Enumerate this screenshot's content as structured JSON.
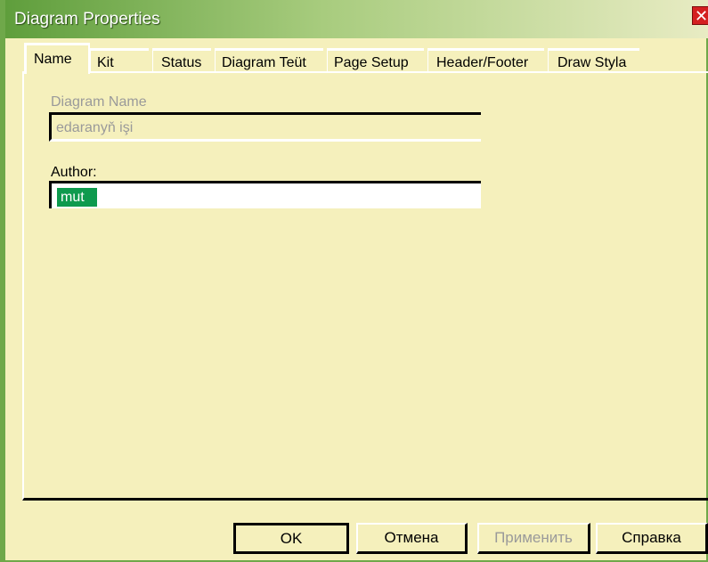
{
  "window": {
    "title": "Diagram Properties",
    "close_glyph": "✕"
  },
  "tabs": [
    {
      "label": "Name",
      "active": true
    },
    {
      "label": "Kit",
      "active": false
    },
    {
      "label": "Status",
      "active": false
    },
    {
      "label": "Diagram Teüt",
      "active": false
    },
    {
      "label": "Page Setup",
      "active": false
    },
    {
      "label": "Header/Footer",
      "active": false
    },
    {
      "label": "Draw Styla",
      "active": false
    }
  ],
  "form": {
    "diagram_name": {
      "label": "Diagram Name",
      "value": "edaranyň işi",
      "enabled": false
    },
    "author": {
      "label": "Author:",
      "value": "mut",
      "selected": true
    }
  },
  "buttons": {
    "ok": "OK",
    "cancel": "Отмена",
    "apply": "Применить",
    "help": "Справка"
  },
  "colors": {
    "accent": "#6fa84a",
    "background": "#f5f0bc",
    "selection": "#0e9a4e",
    "close": "#d42020"
  }
}
